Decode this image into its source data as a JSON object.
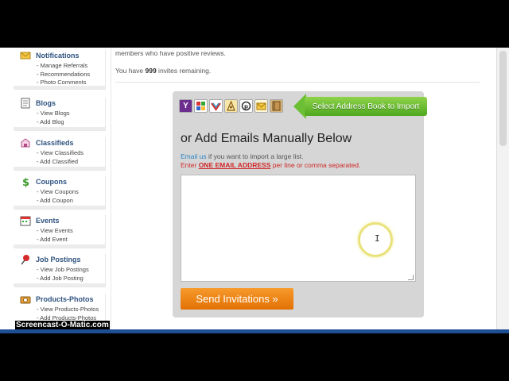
{
  "sidebar": {
    "blocks": [
      {
        "title": "Notifications",
        "icon": "envelope-icon",
        "links": [
          "- Manage Referrals",
          "- Recommendations",
          "- Photo Comments"
        ]
      },
      {
        "title": "Blogs",
        "icon": "document-icon",
        "links": [
          "- View Blogs",
          "- Add Blog"
        ]
      },
      {
        "title": "Classifieds",
        "icon": "classifieds-icon",
        "links": [
          "- View Classifieds",
          "- Add Classified"
        ]
      },
      {
        "title": "Coupons",
        "icon": "dollar-icon",
        "links": [
          "- View Coupons",
          "- Add Coupon"
        ]
      },
      {
        "title": "Events",
        "icon": "calendar-icon",
        "links": [
          "- View Events",
          "- Add Event"
        ]
      },
      {
        "title": "Job Postings",
        "icon": "pushpin-icon",
        "links": [
          "- View Job Postings",
          "- Add Job Posting"
        ]
      },
      {
        "title": "Products-Photos",
        "icon": "products-icon",
        "links": [
          "- View Products-Photos",
          "- Add Products-Photos"
        ]
      }
    ]
  },
  "main": {
    "intro_text": "members who have positive reviews.",
    "invites_prefix": "You have ",
    "invites_count": "999",
    "invites_suffix": " invites remaining.",
    "providers": [
      "yahoo-icon",
      "gmail-icon",
      "aol-icon",
      "contacts-icon",
      "plaxo-icon",
      "mail-icon",
      "addressbook-icon"
    ],
    "address_book_button": "Select Address Book to Import",
    "manual_title": "or Add Emails Manually Below",
    "help_link": "Email us",
    "help_text": " if you want to import a large list.",
    "enter_prefix": "Enter ",
    "enter_strong": "ONE EMAIL ADDRESS",
    "enter_suffix": " per line or comma separated.",
    "emails_value": "",
    "send_button": "Send Invitations »"
  },
  "watermark": "Screencast-O-Matic.com",
  "colors": {
    "accent_green": "#5bb526",
    "send_orange": "#f0850f",
    "link_blue": "#2a83c4",
    "warning_red": "#d02828",
    "title_blue": "#2f5380"
  }
}
